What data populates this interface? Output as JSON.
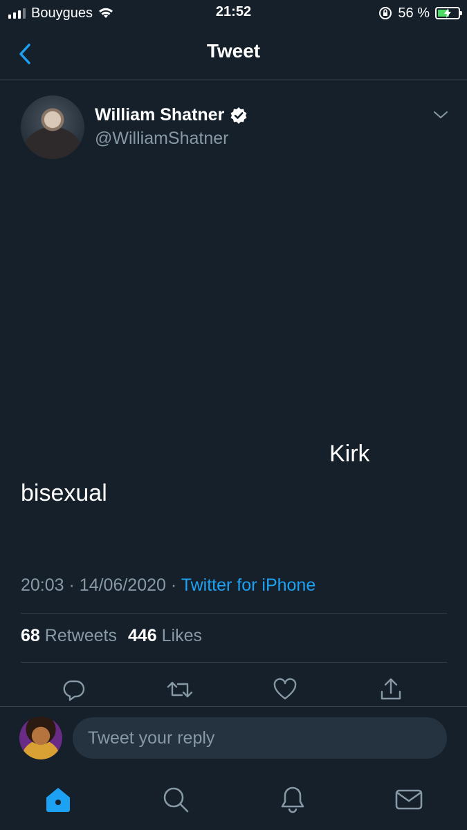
{
  "status_bar": {
    "carrier": "Bouygues",
    "time": "21:52",
    "battery_percent": "56 %",
    "battery_level": 0.56,
    "battery_color": "#4cd964"
  },
  "nav": {
    "title": "Tweet",
    "back_icon": "chevron-left-icon"
  },
  "tweet": {
    "author_name": "William Shatner",
    "verified": true,
    "handle": "@WilliamShatner",
    "text_line1": "Kirk",
    "text_line2": "bisexual",
    "time": "20:03",
    "date": "14/06/2020",
    "separator": "·",
    "source": "Twitter for iPhone",
    "retweets_count": "68",
    "retweets_label": "Retweets",
    "likes_count": "446",
    "likes_label": "Likes"
  },
  "actions": [
    "reply-icon",
    "retweet-icon",
    "like-icon",
    "share-icon"
  ],
  "reply": {
    "placeholder": "Tweet your reply"
  },
  "tabbar": {
    "items": [
      "home-icon",
      "search-icon",
      "notifications-icon",
      "messages-icon"
    ],
    "active": "home-icon"
  },
  "colors": {
    "background": "#15202b",
    "accent": "#1da1f2",
    "secondary_text": "#8899a6",
    "divider": "#38444d"
  }
}
